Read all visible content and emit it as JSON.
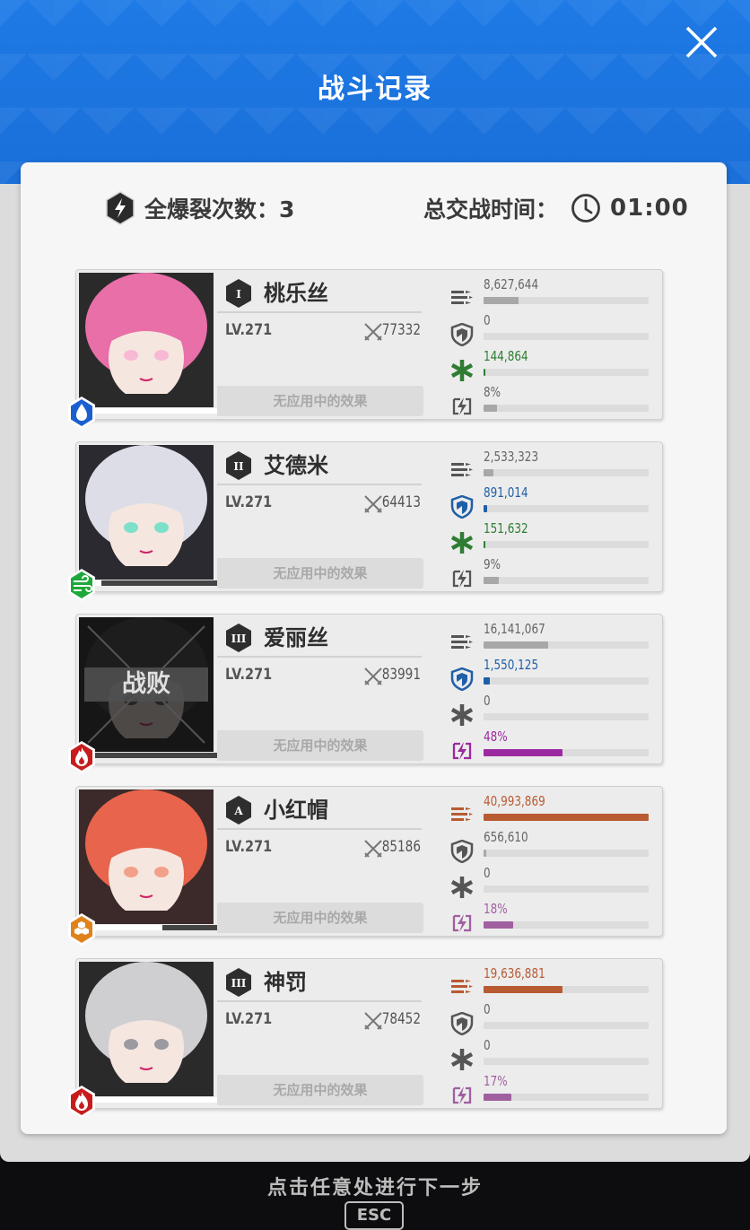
{
  "header": {
    "title": "战斗记录"
  },
  "summary": {
    "full_burst_label": "全爆裂次数：3",
    "battle_time_label": "总交战时间：",
    "battle_time": "01:00"
  },
  "characters": [
    {
      "rank": "I",
      "name": "桃乐丝",
      "level": "LV.271",
      "power": "77332",
      "effect": "无应用中的效果",
      "element": "water",
      "element_color": "#1a5fd0",
      "hp": 1.0,
      "defeated": false,
      "portrait_colors": [
        "#e86fa8",
        "#f7b9d4",
        "#2a2a2a"
      ],
      "stats": {
        "damage": "8,627,644",
        "damage_ratio": 0.21,
        "shield": "0",
        "shield_ratio": 0.0,
        "heal": "144,864",
        "heal_ratio": 0.005,
        "burst": "8%",
        "burst_ratio": 0.08
      }
    },
    {
      "rank": "II",
      "name": "艾德米",
      "level": "LV.271",
      "power": "64413",
      "effect": "无应用中的效果",
      "element": "wind",
      "element_color": "#1fa83a",
      "hp": 0.05,
      "defeated": false,
      "portrait_colors": [
        "#dcdde6",
        "#7de0c8",
        "#2a2a30"
      ],
      "stats": {
        "damage": "2,533,323",
        "damage_ratio": 0.06,
        "shield": "891,014",
        "shield_ratio": 0.02,
        "heal": "151,632",
        "heal_ratio": 0.005,
        "burst": "9%",
        "burst_ratio": 0.09
      }
    },
    {
      "rank": "III",
      "name": "爱丽丝",
      "level": "LV.271",
      "power": "83991",
      "effect": "无应用中的效果",
      "element": "fire",
      "element_color": "#c81c1c",
      "hp": 0.0,
      "defeated": true,
      "defeat_label": "战败",
      "portrait_colors": [
        "#3a3a3a",
        "#555555",
        "#1c1c1c"
      ],
      "stats": {
        "damage": "16,141,067",
        "damage_ratio": 0.39,
        "shield": "1,550,125",
        "shield_ratio": 0.04,
        "heal": "0",
        "heal_ratio": 0.0,
        "burst": "48%",
        "burst_ratio": 0.48
      }
    },
    {
      "rank": "A",
      "name": "小红帽",
      "level": "LV.271",
      "power": "85186",
      "effect": "无应用中的效果",
      "element": "iron",
      "element_color": "#e0821c",
      "hp": 0.55,
      "defeated": false,
      "portrait_colors": [
        "#e8644c",
        "#f2a08a",
        "#3c2a2a"
      ],
      "stats": {
        "damage": "40,993,869",
        "damage_ratio": 1.0,
        "shield": "656,610",
        "shield_ratio": 0.015,
        "heal": "0",
        "heal_ratio": 0.0,
        "burst": "18%",
        "burst_ratio": 0.18
      }
    },
    {
      "rank": "III",
      "name": "神罚",
      "level": "LV.271",
      "power": "78452",
      "effect": "无应用中的效果",
      "element": "fire",
      "element_color": "#c81c1c",
      "hp": 1.0,
      "defeated": false,
      "portrait_colors": [
        "#cfcfd2",
        "#9a9aa0",
        "#2a2a2a"
      ],
      "stats": {
        "damage": "19,636,881",
        "damage_ratio": 0.48,
        "shield": "0",
        "shield_ratio": 0.0,
        "heal": "0",
        "heal_ratio": 0.0,
        "burst": "17%",
        "burst_ratio": 0.17
      }
    }
  ],
  "colors": {
    "damage_default": "#a8a8a8",
    "damage_top": "#b85a32",
    "shield_default": "#a8a8a8",
    "shield_active": "#1f5fa8",
    "shield_value": "#1f5fa8",
    "heal_active": "#2e7d32",
    "heal_icon": "#2e7d32",
    "burst_high": "#9b2aa0",
    "burst_mid": "#a060a0",
    "burst_low": "#a8a8a8"
  },
  "footer": {
    "hint": "点击任意处进行下一步",
    "esc_label": "ESC"
  }
}
